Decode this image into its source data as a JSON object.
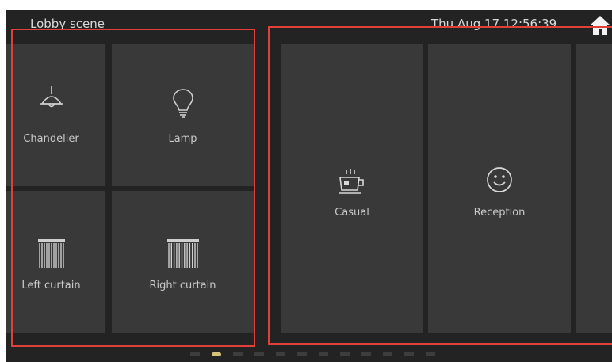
{
  "header": {
    "title": "Lobby scene",
    "datetime": "Thu Aug 17  12:56:39",
    "home_icon": "home-icon"
  },
  "devices": [
    {
      "label": "Chandelier",
      "icon": "chandelier-icon"
    },
    {
      "label": "Lamp",
      "icon": "lightbulb-icon"
    },
    {
      "label": "Left curtain",
      "icon": "curtain-icon"
    },
    {
      "label": "Right curtain",
      "icon": "curtain-icon"
    }
  ],
  "scenes": [
    {
      "label": "Casual",
      "icon": "coffee-cup-icon"
    },
    {
      "label": "Reception",
      "icon": "smiley-face-icon"
    }
  ],
  "pager": {
    "count": 12,
    "active_index": 1
  },
  "colors": {
    "background": "#232323",
    "tile": "#393939",
    "text": "#c9c9c9",
    "highlight": "#e0403a",
    "active_dot": "#d7c27a"
  }
}
